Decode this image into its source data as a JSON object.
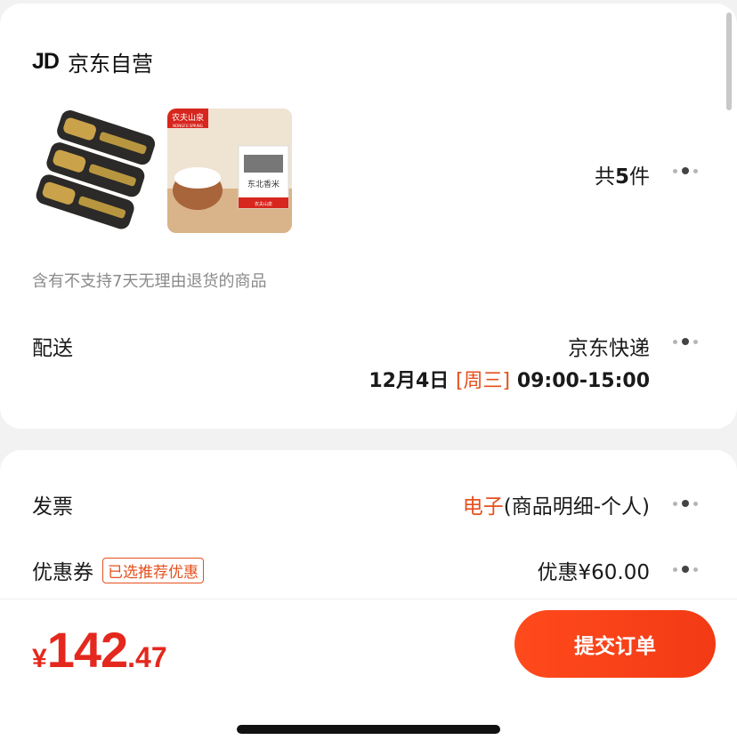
{
  "store": {
    "logo": "JD",
    "name": "京东自营"
  },
  "products": {
    "count_prefix": "共",
    "count": "5",
    "count_suffix": "件",
    "items": [
      {
        "name": "product-thumb-1"
      },
      {
        "name": "product-thumb-2",
        "brand_tag": "农夫山泉",
        "brand_sub": "NONGFU SPRING",
        "package_label": "东北香米",
        "package_foot": "农夫山泉"
      }
    ]
  },
  "notice": "含有不支持7天无理由退货的商品",
  "delivery": {
    "label": "配送",
    "method": "京东快递",
    "date": "12月4日",
    "day": "[周三]",
    "time": "09:00-15:00"
  },
  "invoice": {
    "label": "发票",
    "type": "电子",
    "detail": "(商品明细-个人)"
  },
  "coupon": {
    "label": "优惠券",
    "tag": "已选推荐优惠",
    "value": "优惠¥60.00"
  },
  "checkout": {
    "currency": "¥",
    "price_int": "142",
    "price_dec": ".47",
    "submit_label": "提交订单"
  },
  "colors": {
    "accent": "#e4501e",
    "price": "#e4281e",
    "button": "#ff4a1c"
  },
  "icons": [
    "more-dots-icon"
  ]
}
